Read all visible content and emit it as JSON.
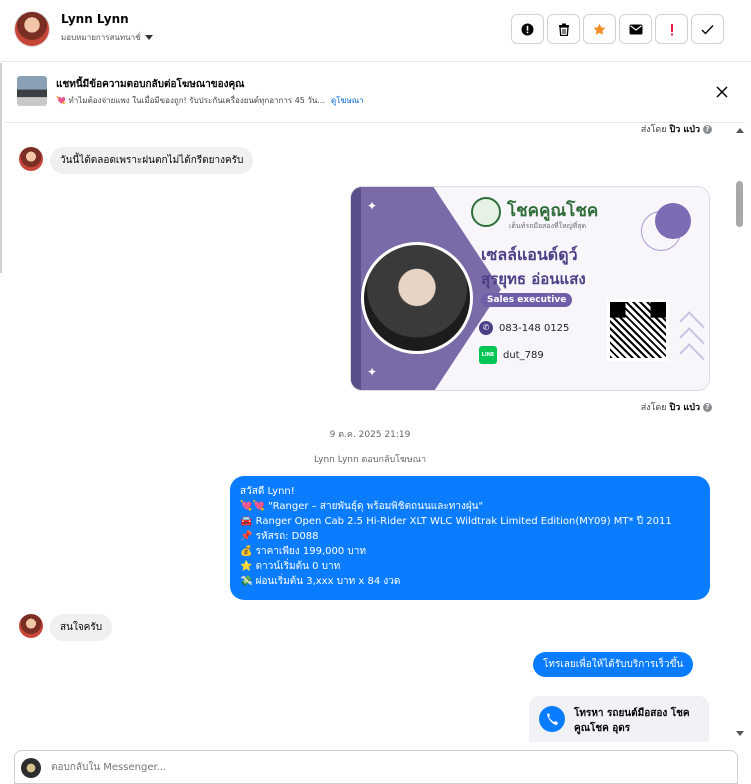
{
  "header": {
    "contact_name": "Lynn Lynn",
    "assign_label": "มอบหมายการสนทนาชั่",
    "actions": [
      {
        "name": "exclamation-circle-icon",
        "color": "#050505"
      },
      {
        "name": "trash-icon",
        "color": "#050505"
      },
      {
        "name": "star-icon",
        "color": "#f28c28"
      },
      {
        "name": "envelope-icon",
        "color": "#050505"
      },
      {
        "name": "exclamation-icon",
        "color": "#e41e3f"
      },
      {
        "name": "check-icon",
        "color": "#050505"
      }
    ]
  },
  "ad_banner": {
    "title": "แชทนี้มีข้อความตอบกลับต่อโฆษณาของคุณ",
    "subtitle": "💘 ทำไมต้องจ่ายแพง ในเมื่อมีของถูก! รับประกันเครื่องยนต์ทุกอาการ 45 วัน...",
    "link": "ดูโฆษณา"
  },
  "messages": {
    "sent_by_label": "ส่งโดย",
    "sent_by_name": "ปิว แป่ว",
    "msg1": "วันนี้ได้ตลอดเพราะฝนตกไม่ได้กรีดยางครับ",
    "date": "9 ต.ค. 2025 21:19",
    "reply_note": "Lynn Lynn ตอบกลับโฆษณา",
    "main_lines": [
      "สวัสดี Lynn!",
      "💘💘 \"Ranger – สายพันธุ์ดุ พร้อมพิชิตถนนและทางฝุ่น\"",
      "🚘  Ranger Open Cab 2.5 Hi-Rider XLT WLC Wildtrak Limited Edition(MY09) MT* ปี 2011",
      "📌 รหัสรถ: D088",
      "💰 ราคาเพียง 199,000 บาท",
      "⭐ ดาวน์เริ่มต้น 0 บาท",
      "💸 ผ่อนเริ่มต้น 3,xxx บาท x 84 งวด"
    ],
    "msg_interested": "สนใจครับ",
    "btn_call": "โทรเลยเพื่อให้ได้รับบริการเร็วขึ้น",
    "call_card": "โทรหา รถยนต์มือสอง โชคคูณโชค อุดร"
  },
  "business_card": {
    "brand": "โชคคูณโชค",
    "tagline": "เต็นท์รถมือสองที่ใหญ่ที่สุด",
    "name_line1": "เซลล์แอนด์ดูว์",
    "name_line2": "สุรยุทธ อ่อนแสง",
    "role": "Sales executive",
    "phone": "083-148 0125",
    "line_id": "dut_789",
    "line_badge": "LINE",
    "accent": "#4b3f86"
  },
  "composer": {
    "placeholder": "ตอบกลับใน Messenger..."
  }
}
